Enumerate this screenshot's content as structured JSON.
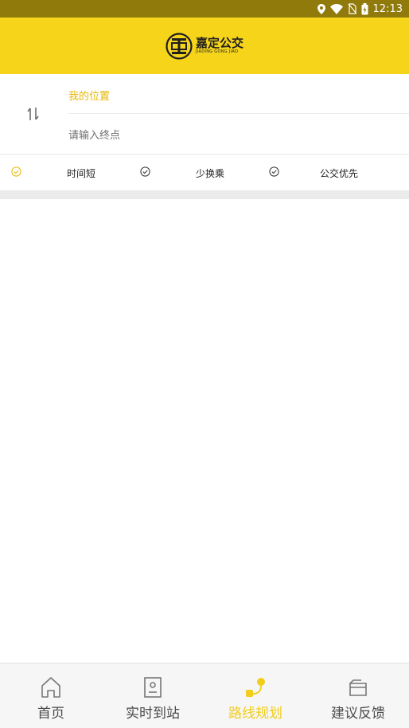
{
  "status_bar": {
    "time": "12:13"
  },
  "header": {
    "logo_text_cn": "嘉定公交",
    "logo_text_en": "JIADING GONG JIAO",
    "logo_mark_text": "嘉"
  },
  "route": {
    "origin_label": "我的位置",
    "destination_placeholder": "请输入终点"
  },
  "preferences": [
    {
      "label": "时间短",
      "selected": true
    },
    {
      "label": "少换乘",
      "selected": false
    },
    {
      "label": "公交优先",
      "selected": false
    }
  ],
  "tabs": [
    {
      "label": "首页",
      "icon": "home-icon",
      "active": false
    },
    {
      "label": "实时到站",
      "icon": "bus-stop-icon",
      "active": false
    },
    {
      "label": "路线规划",
      "icon": "route-icon",
      "active": true
    },
    {
      "label": "建议反馈",
      "icon": "feedback-icon",
      "active": false
    }
  ],
  "colors": {
    "status_bar": "#8f7a0b",
    "brand_yellow": "#f5d41a",
    "active_tab": "#f2cd1b",
    "origin_text": "#e7b800"
  }
}
